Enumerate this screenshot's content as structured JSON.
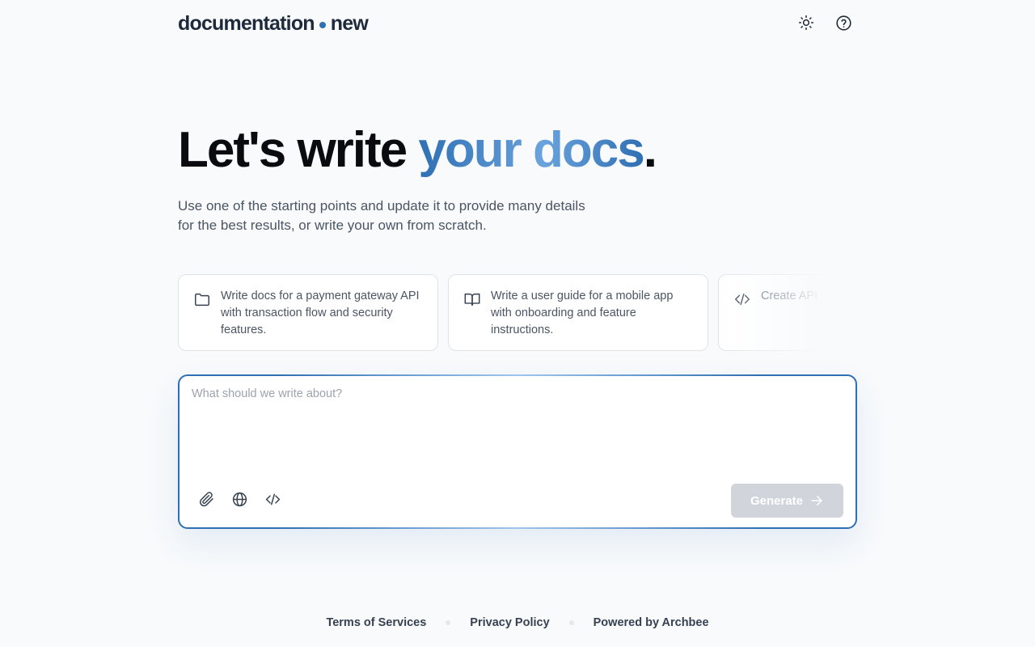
{
  "header": {
    "logo_left": "documentation",
    "logo_right": "new",
    "theme_toggle_icon": "sun-icon",
    "help_icon": "help-circle-icon"
  },
  "hero": {
    "title_prefix": "Let's write ",
    "title_accent": "your docs",
    "title_suffix": ".",
    "subtitle_line1": "Use one of the starting points and update it to provide many details",
    "subtitle_line2": "for the best results, or write your own from scratch."
  },
  "cards": [
    {
      "icon": "folder-icon",
      "text": "Write docs for a payment gateway API with transaction flow and security features."
    },
    {
      "icon": "book-open-icon",
      "text": "Write a user guide for a mobile app with onboarding and feature instructions."
    },
    {
      "icon": "code-icon",
      "text": "Create API weather da authenticat"
    }
  ],
  "composer": {
    "placeholder": "What should we write about?",
    "value": "",
    "tools": [
      "paperclip-icon",
      "globe-icon",
      "code-icon"
    ],
    "generate_label": "Generate"
  },
  "footer": {
    "terms": "Terms of Services",
    "privacy": "Privacy Policy",
    "powered": "Powered by Archbee"
  },
  "colors": {
    "accent": "#2f6fb3",
    "accent_light": "#6aa3dc",
    "background": "#f8fafc",
    "button_disabled": "#d1d5db"
  }
}
